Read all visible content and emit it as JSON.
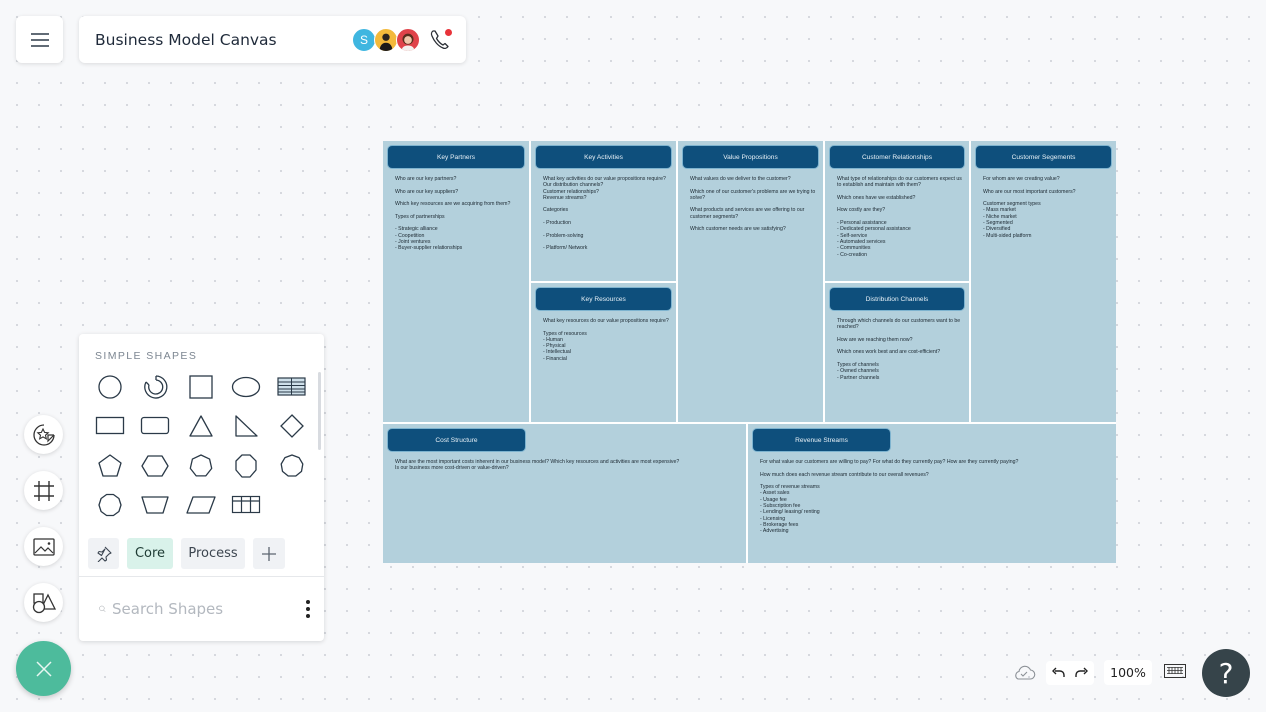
{
  "header": {
    "title": "Business Model Canvas",
    "collaborators": [
      {
        "initial": "S",
        "color": "#3fb6e0"
      },
      {
        "initial": "",
        "color": "#f3b93b"
      },
      {
        "initial": "",
        "color": "#e0434a"
      }
    ],
    "call_status_color": "#e8333a"
  },
  "left_rail": {
    "items": [
      "stickers",
      "frame",
      "image",
      "shapes"
    ],
    "fab_color": "#4dbb9c"
  },
  "shape_panel": {
    "heading": "SIMPLE SHAPES",
    "shapes": [
      "circle",
      "partial-ring",
      "square",
      "ellipse",
      "table",
      "rectangle",
      "rounded-rectangle",
      "triangle",
      "right-triangle",
      "diamond",
      "pentagon",
      "hexagon",
      "heptagon",
      "octagon",
      "nonagon",
      "decagon",
      "trapezoid",
      "parallelogram",
      "grid-table"
    ],
    "tabs": [
      {
        "label": "Core",
        "active": true
      },
      {
        "label": "Process",
        "active": false
      }
    ],
    "search_placeholder": "Search Shapes"
  },
  "bottom_toolbar": {
    "zoom_level": "100%"
  },
  "canvas": {
    "header_color": "#0e4f7c",
    "section_color": "#b3d0dc",
    "sections": {
      "key_partners": {
        "title": "Key Partners",
        "lines": [
          "Who are our key partners?",
          "Who are our key suppliers?",
          "Which key resources are we acquiring from them?",
          "Types of partnerships",
          "- Strategic alliance\n- Coopetition\n- Joint ventures\n- Buyer-supplier relationships"
        ]
      },
      "key_activities": {
        "title": "Key Activities",
        "lines": [
          "What key activities do our value propositions require?\nOur distribution channels?\nCustomer relationships?\nRevenue streams?",
          "Categories",
          "- Production",
          "- Problem-solving",
          "- Platform/ Network"
        ]
      },
      "value_propositions": {
        "title": "Value Propositions",
        "lines": [
          "What values do we deliver to the customer?",
          "Which one of our customer's problems are we trying to solve?",
          "What products and services are we offering to our customer segments?",
          "Which customer needs are we satisfying?"
        ]
      },
      "customer_relationships": {
        "title": "Customer Relationships",
        "lines": [
          "What type of relationships do our customers expect us to establish and maintain with them?",
          "Which ones have we established?",
          "How costly are they?",
          "- Personal assistance\n- Dedicated personal assistance\n- Self-service\n- Automated services\n- Communities\n- Co-creation"
        ]
      },
      "customer_segments": {
        "title": "Customer Segements",
        "lines": [
          "For whom are we creating value?",
          "Who are our most important customers?",
          "Customer segment types\n- Mass market\n- Niche market\n- Segmented\n- Diversified\n- Multi-sided platform"
        ]
      },
      "key_resources": {
        "title": "Key Resources",
        "lines": [
          "What key resources do our value propositions require?",
          "Types of resources\n- Human\n- Physical\n- Intellectual\n- Financial"
        ]
      },
      "distribution_channels": {
        "title": "Distribution Channels",
        "lines": [
          "Through which channels do our customers want to be reached?",
          "How are we reaching them now?",
          "Which ones work best and are cost-efficient?",
          "Types of channels\n- Owned channels\n- Partner channels"
        ]
      },
      "cost_structure": {
        "title": "Cost Structure",
        "lines": [
          "What are the most important costs inherent in our business model? Which key resources and activities are most expensive?\nIs our business more cost-driven or value-driven?"
        ]
      },
      "revenue_streams": {
        "title": "Revenue Streams",
        "lines": [
          "For what value our customers are willing to pay? For what do they currently pay? How are they currently paying?",
          "How much does each revenue stream contribute to our overall revenues?",
          "Types of revenue streams\n- Asset sales\n- Usage fee\n- Subscription fee\n- Lending/ leasing/ renting\n- Licensing\n- Brokerage fees\n- Advertising"
        ]
      }
    }
  }
}
